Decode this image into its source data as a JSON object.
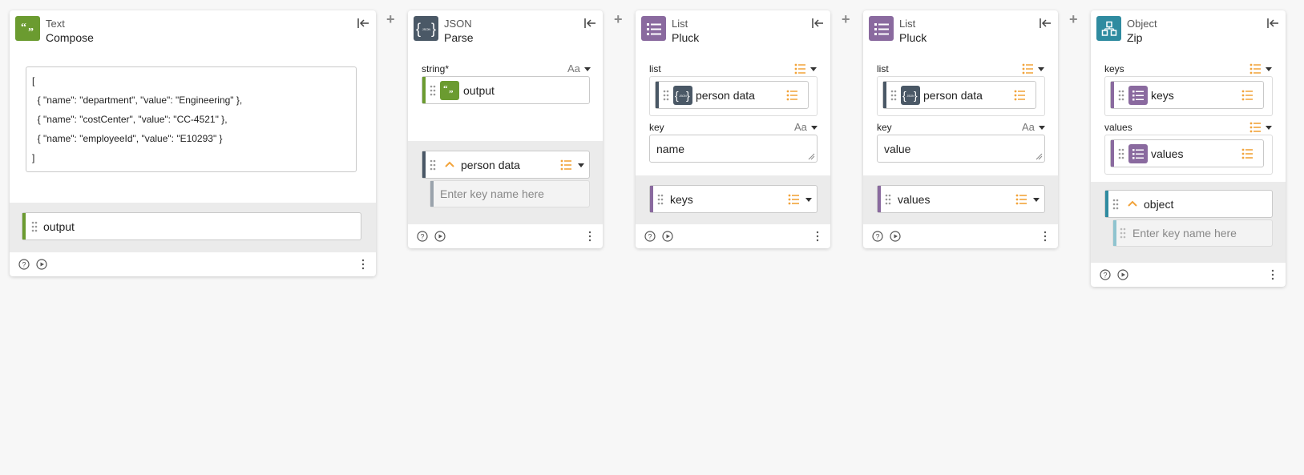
{
  "cards": [
    {
      "category": "Text",
      "name": "Compose",
      "icon": "quote-icon",
      "color": "#6b9b30",
      "code_lines": [
        "[",
        "  { \"name\": \"department\", \"value\": \"Engineering\" },",
        "  { \"name\": \"costCenter\", \"value\": \"CC-4521\" },",
        "  { \"name\": \"employeeId\", \"value\": \"E10293\" }",
        "]"
      ],
      "output_label": "output"
    },
    {
      "category": "JSON",
      "name": "Parse",
      "icon": "json-icon",
      "color": "#4a5866",
      "input_label": "string*",
      "input_type": "Aa",
      "input_ref": "output",
      "output_label": "person data",
      "key_placeholder": "Enter key name here"
    },
    {
      "category": "List",
      "name": "Pluck",
      "icon": "list-icon",
      "color": "#8a6a9f",
      "list_label": "list",
      "list_ref": "person data",
      "key_label": "key",
      "key_type": "Aa",
      "key_value": "name",
      "output_label": "keys"
    },
    {
      "category": "List",
      "name": "Pluck",
      "icon": "list-icon",
      "color": "#8a6a9f",
      "list_label": "list",
      "list_ref": "person data",
      "key_label": "key",
      "key_type": "Aa",
      "key_value": "value",
      "output_label": "values"
    },
    {
      "category": "Object",
      "name": "Zip",
      "icon": "object-icon",
      "color": "#2f8ba0",
      "keys_label": "keys",
      "keys_ref": "keys",
      "values_label": "values",
      "values_ref": "values",
      "output_label": "object",
      "key_placeholder": "Enter key name here"
    }
  ],
  "colors": {
    "accent_list": "#f2a33a",
    "text_green": "#6b9b30",
    "json_slate": "#4a5866",
    "list_purple": "#8a6a9f",
    "object_teal": "#2f8ba0"
  }
}
